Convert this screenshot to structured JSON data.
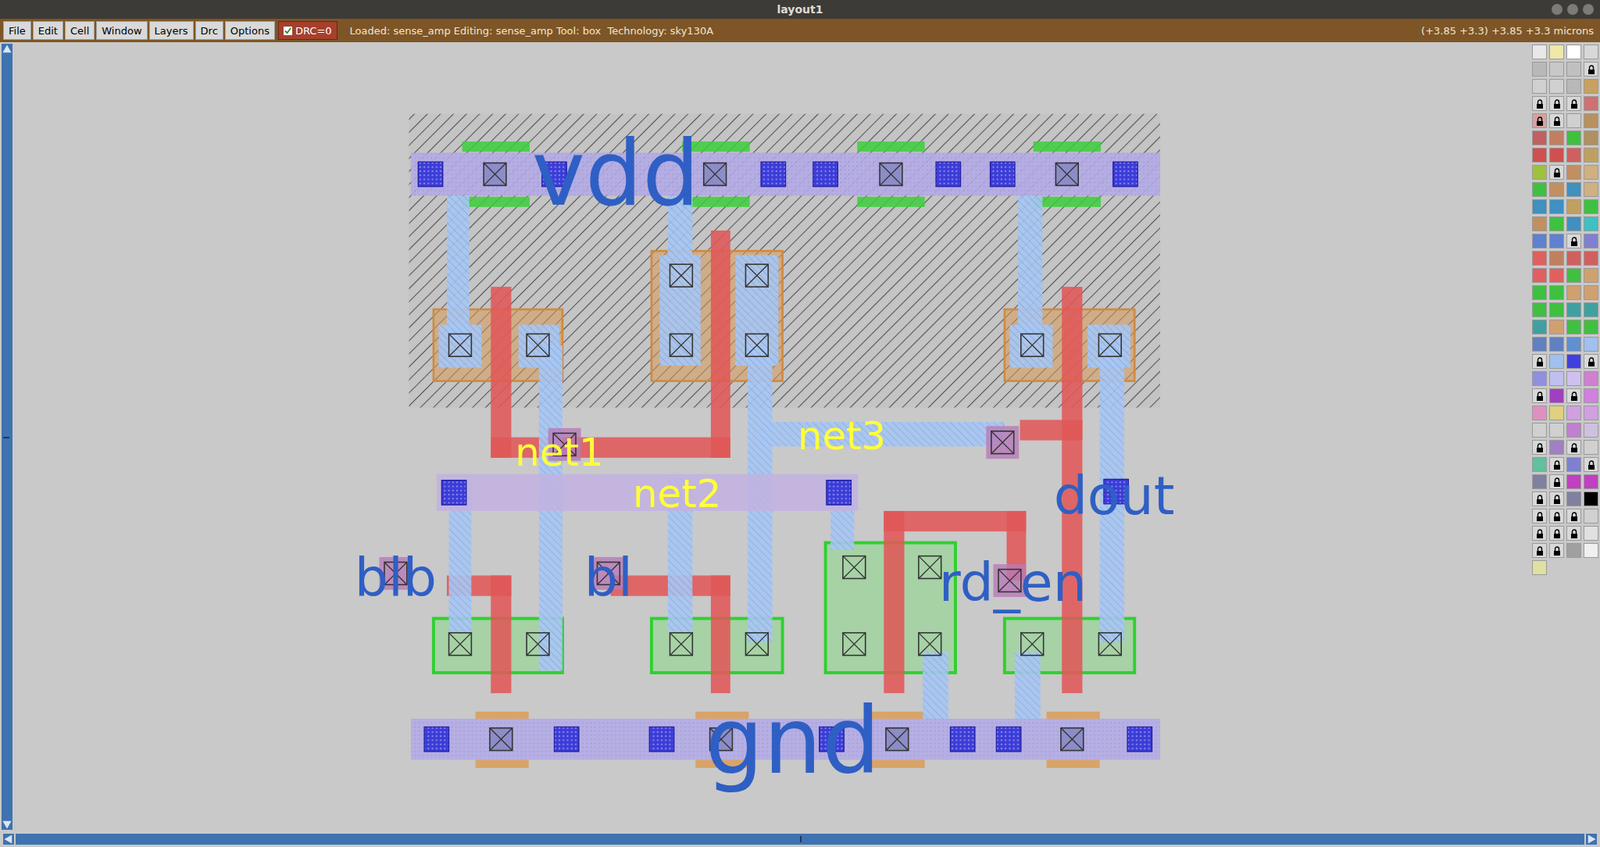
{
  "window": {
    "title": "layout1"
  },
  "menu": [
    "File",
    "Edit",
    "Cell",
    "Window",
    "Layers",
    "Drc",
    "Options"
  ],
  "drc": {
    "label": "DRC=0",
    "checked": true
  },
  "status": "Loaded: sense_amp Editing: sense_amp Tool: box  Technology: sky130A",
  "coordinates": "(+3.85 +3.3) +3.85 +3.3 microns",
  "labels": [
    {
      "text": "vdd",
      "color": "#2f5fc4"
    },
    {
      "text": "gnd",
      "color": "#2f5fc4"
    },
    {
      "text": "net1",
      "color": "#ffff3a"
    },
    {
      "text": "net2",
      "color": "#ffff3a"
    },
    {
      "text": "net3",
      "color": "#ffff3a"
    },
    {
      "text": "blb",
      "color": "#2f5fc4"
    },
    {
      "text": "bl",
      "color": "#2f5fc4"
    },
    {
      "text": "rd_en",
      "color": "#2f5fc4"
    },
    {
      "text": "dout",
      "color": "#2f5fc4"
    }
  ],
  "palette": [
    [
      {
        "color": "#e8e8e8",
        "locked": false
      },
      {
        "color": "#f0e8a8",
        "locked": false
      },
      {
        "color": "#ffffff",
        "locked": false
      },
      {
        "color": "#d8d8d8",
        "locked": false
      }
    ],
    [
      {
        "color": "#b8b8b8",
        "locked": false
      },
      {
        "color": "#c8c8c8",
        "locked": false
      },
      {
        "color": "#c0c0c0",
        "locked": false
      },
      {
        "color": "#d8d8d8",
        "locked": true
      }
    ],
    [
      {
        "color": "#d0d0d0",
        "locked": false
      },
      {
        "color": "#d0d0d0",
        "locked": false
      },
      {
        "color": "#b8b8b8",
        "locked": false
      },
      {
        "color": "#c8a060",
        "locked": false
      }
    ],
    [
      {
        "color": "#d8d8d8",
        "locked": true
      },
      {
        "color": "#d8d8d8",
        "locked": true
      },
      {
        "color": "#d8d8d8",
        "locked": true
      },
      {
        "color": "#d07070",
        "locked": false
      }
    ],
    [
      {
        "color": "#d8a0a0",
        "locked": true
      },
      {
        "color": "#d8d8d8",
        "locked": true
      },
      {
        "color": "#d0d0d0",
        "locked": false
      },
      {
        "color": "#b89060",
        "locked": false
      }
    ],
    [
      {
        "color": "#c06060",
        "locked": false
      },
      {
        "color": "#c08060",
        "locked": false
      },
      {
        "color": "#40c040",
        "locked": false
      },
      {
        "color": "#b09060",
        "locked": false
      }
    ],
    [
      {
        "color": "#d05050",
        "locked": false
      },
      {
        "color": "#d05050",
        "locked": false
      },
      {
        "color": "#d06060",
        "locked": false
      },
      {
        "color": "#c0a060",
        "locked": false
      }
    ],
    [
      {
        "color": "#a0c040",
        "locked": false
      },
      {
        "color": "#d8d8d8",
        "locked": true
      },
      {
        "color": "#c09060",
        "locked": false
      },
      {
        "color": "#d0b080",
        "locked": false
      }
    ],
    [
      {
        "color": "#40c040",
        "locked": false
      },
      {
        "color": "#c09060",
        "locked": false
      },
      {
        "color": "#4090c0",
        "locked": false
      },
      {
        "color": "#d0b080",
        "locked": false
      }
    ],
    [
      {
        "color": "#4090c0",
        "locked": false
      },
      {
        "color": "#4090c0",
        "locked": false
      },
      {
        "color": "#c0a060",
        "locked": false
      },
      {
        "color": "#40c040",
        "locked": false
      }
    ],
    [
      {
        "color": "#c09060",
        "locked": false
      },
      {
        "color": "#40c040",
        "locked": false
      },
      {
        "color": "#4090c0",
        "locked": false
      },
      {
        "color": "#40c0c0",
        "locked": false
      }
    ],
    [
      {
        "color": "#6080d0",
        "locked": false
      },
      {
        "color": "#6080d0",
        "locked": false
      },
      {
        "color": "#d8d8d8",
        "locked": true
      },
      {
        "color": "#8080d0",
        "locked": false
      }
    ],
    [
      {
        "color": "#e06060",
        "locked": false
      },
      {
        "color": "#c08060",
        "locked": false
      },
      {
        "color": "#d06060",
        "locked": false
      },
      {
        "color": "#d06060",
        "locked": false
      }
    ],
    [
      {
        "color": "#e06060",
        "locked": false
      },
      {
        "color": "#e06060",
        "locked": false
      },
      {
        "color": "#40c040",
        "locked": false
      },
      {
        "color": "#d0a070",
        "locked": false
      }
    ],
    [
      {
        "color": "#40c040",
        "locked": false
      },
      {
        "color": "#40c040",
        "locked": false
      },
      {
        "color": "#d0a070",
        "locked": false
      },
      {
        "color": "#d0a070",
        "locked": false
      }
    ],
    [
      {
        "color": "#40c040",
        "locked": false
      },
      {
        "color": "#40c040",
        "locked": false
      },
      {
        "color": "#40a0a0",
        "locked": false
      },
      {
        "color": "#40a0a0",
        "locked": false
      }
    ],
    [
      {
        "color": "#40a0a0",
        "locked": false
      },
      {
        "color": "#d0a070",
        "locked": false
      },
      {
        "color": "#40c040",
        "locked": false
      },
      {
        "color": "#40c040",
        "locked": false
      }
    ],
    [
      {
        "color": "#6080c0",
        "locked": false
      },
      {
        "color": "#6080c0",
        "locked": false
      },
      {
        "color": "#6090d0",
        "locked": false
      },
      {
        "color": "#a0c0f0",
        "locked": false
      }
    ],
    [
      {
        "color": "#d8d8d8",
        "locked": true
      },
      {
        "color": "#a0c0f0",
        "locked": false
      },
      {
        "color": "#4040e0",
        "locked": false
      },
      {
        "color": "#d8d8d8",
        "locked": true
      }
    ],
    [
      {
        "color": "#9090e0",
        "locked": false
      },
      {
        "color": "#c0c0f0",
        "locked": false
      },
      {
        "color": "#d0c0f0",
        "locked": false
      },
      {
        "color": "#d080d0",
        "locked": false
      }
    ],
    [
      {
        "color": "#d8d8d8",
        "locked": true
      },
      {
        "color": "#a040c0",
        "locked": false
      },
      {
        "color": "#d8d8d8",
        "locked": true
      },
      {
        "color": "#d080e0",
        "locked": false
      }
    ],
    [
      {
        "color": "#e090c0",
        "locked": false
      },
      {
        "color": "#e0d080",
        "locked": false
      },
      {
        "color": "#d0a0e0",
        "locked": false
      },
      {
        "color": "#d0a0e0",
        "locked": false
      }
    ],
    [
      {
        "color": "#d0d0d0",
        "locked": false
      },
      {
        "color": "#d0d0d0",
        "locked": false
      },
      {
        "color": "#c080d0",
        "locked": false
      },
      {
        "color": "#d0c0e0",
        "locked": false
      }
    ],
    [
      {
        "color": "#d8d8d8",
        "locked": true
      },
      {
        "color": "#a080c0",
        "locked": false
      },
      {
        "color": "#d8d8d8",
        "locked": true
      },
      {
        "color": "#d0d0d0",
        "locked": false
      }
    ],
    [
      {
        "color": "#60c0a0",
        "locked": false
      },
      {
        "color": "#d8d8d8",
        "locked": true
      },
      {
        "color": "#8080d0",
        "locked": false
      },
      {
        "color": "#d8d8d8",
        "locked": true
      }
    ],
    [
      {
        "color": "#8080a0",
        "locked": false
      },
      {
        "color": "#d8d8d8",
        "locked": true
      },
      {
        "color": "#c040c0",
        "locked": false
      },
      {
        "color": "#c040c0",
        "locked": false
      }
    ],
    [
      {
        "color": "#d8d8d8",
        "locked": true
      },
      {
        "color": "#d8d8d8",
        "locked": true
      },
      {
        "color": "#8080a0",
        "locked": false
      },
      {
        "color": "#000000",
        "locked": false
      }
    ],
    [
      {
        "color": "#d8d8d8",
        "locked": true
      },
      {
        "color": "#d8d8d8",
        "locked": true
      },
      {
        "color": "#d8d8d8",
        "locked": true
      },
      {
        "color": "#d0d0d0",
        "locked": false
      }
    ],
    [
      {
        "color": "#d8d8d8",
        "locked": true
      },
      {
        "color": "#d8d8d8",
        "locked": true
      },
      {
        "color": "#d8d8d8",
        "locked": true
      },
      {
        "color": "#e0e0e0",
        "locked": false
      }
    ],
    [
      {
        "color": "#d8d8d8",
        "locked": true
      },
      {
        "color": "#d8d8d8",
        "locked": true
      },
      {
        "color": "#a0a0a0",
        "locked": false
      },
      {
        "color": "#f0f0f0",
        "locked": false
      }
    ],
    [
      {
        "color": "#e0e0a0",
        "locked": false
      }
    ]
  ]
}
